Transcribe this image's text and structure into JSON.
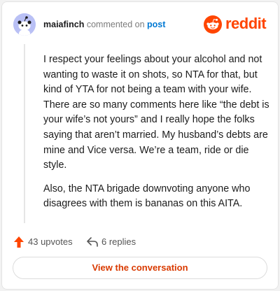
{
  "header": {
    "username": "maiafinch",
    "commented_on_text": "commented on",
    "post_link_label": "post",
    "brand_name": "reddit"
  },
  "comment": {
    "paragraphs": [
      "I respect your feelings about your alcohol and not wanting to waste it on shots, so NTA for that, but kind of YTA for not being a team with your wife. There are so many comments here like “the debt is your wife’s not yours” and I really hope the folks saying that aren’t married. My husband’s debts are mine and Vice versa. We’re a team, ride or die style.",
      "Also, the NTA brigade downvoting anyone who disagrees with them is bananas on this AITA."
    ]
  },
  "actions": {
    "upvotes_label": "43 upvotes",
    "replies_label": "6 replies"
  },
  "cta": {
    "view_conversation_label": "View the conversation"
  },
  "icons": {
    "avatar": "snoo-avatar-icon",
    "brand": "reddit-logo-icon",
    "upvote": "upvote-arrow-icon",
    "reply": "reply-arrow-icon"
  },
  "colors": {
    "brand": "#ff4500",
    "link": "#0079d3",
    "cta_text": "#d93a00",
    "avatar_bg": "#b9c0f5"
  }
}
